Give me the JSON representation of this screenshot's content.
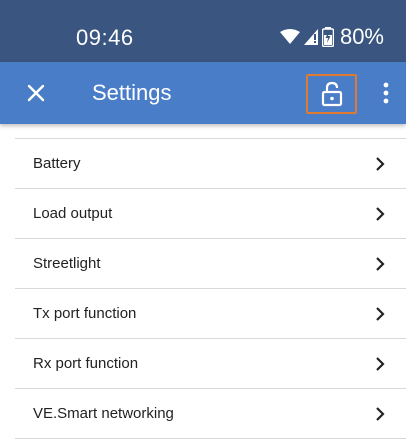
{
  "status_bar": {
    "time": "09:46",
    "battery": "80%"
  },
  "app_bar": {
    "title": "Settings",
    "close_icon": "close-icon",
    "lock_icon": "lock-open-icon",
    "menu_icon": "more-vertical-icon"
  },
  "colors": {
    "status_bar_bg": "#3a5580",
    "app_bar_bg": "#4a7dc8",
    "highlight": "#e07a2e"
  },
  "settings": {
    "items": [
      {
        "label": "Battery"
      },
      {
        "label": "Load output"
      },
      {
        "label": "Streetlight"
      },
      {
        "label": "Tx port function"
      },
      {
        "label": "Rx port function"
      },
      {
        "label": "VE.Smart networking"
      }
    ]
  }
}
